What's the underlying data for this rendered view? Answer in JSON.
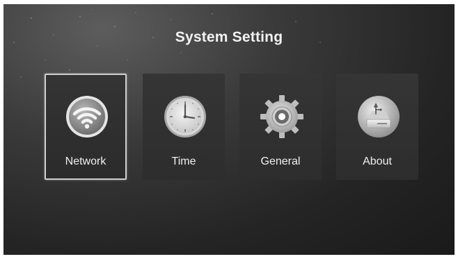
{
  "screen": {
    "title": "System Setting"
  },
  "menu": {
    "items": [
      {
        "label": "Network",
        "icon": "wifi-icon",
        "selected": true
      },
      {
        "label": "Time",
        "icon": "clock-icon",
        "selected": false
      },
      {
        "label": "General",
        "icon": "gear-icon",
        "selected": false
      },
      {
        "label": "About",
        "icon": "drive-info-icon",
        "selected": false
      }
    ]
  }
}
